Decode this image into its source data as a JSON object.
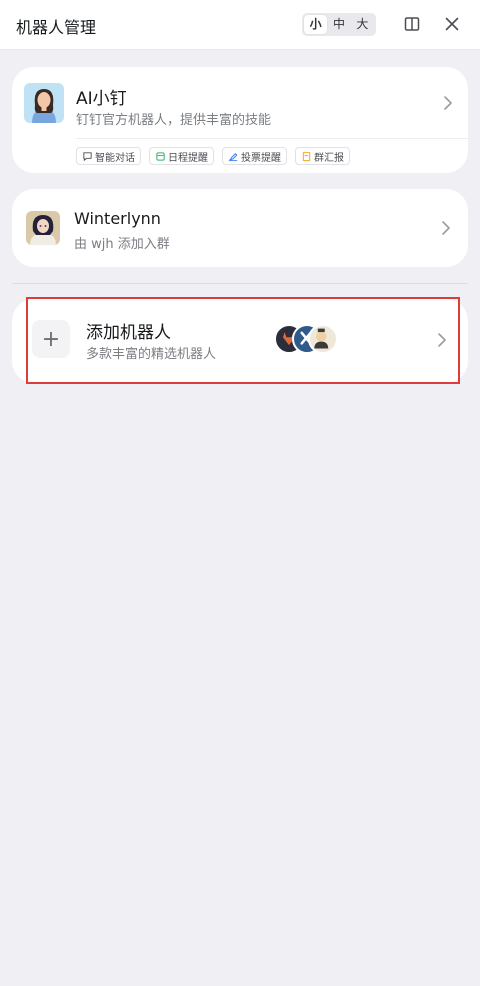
{
  "header": {
    "title": "机器人管理",
    "size_options": [
      "小",
      "中",
      "大"
    ],
    "size_selected": "小",
    "icons": [
      "split-panel-icon",
      "close-icon"
    ]
  },
  "bots": [
    {
      "name": "AI小钉",
      "description": "钉钉官方机器人，提供丰富的技能",
      "tags": [
        {
          "label": "智能对话",
          "icon": "chat-bubble-icon",
          "color": "#4a4d52"
        },
        {
          "label": "日程提醒",
          "icon": "calendar-icon",
          "color": "#33b36b"
        },
        {
          "label": "投票提醒",
          "icon": "vote-icon",
          "color": "#3d7ef5"
        },
        {
          "label": "群汇报",
          "icon": "report-icon",
          "color": "#f5a623"
        }
      ]
    },
    {
      "name": "Winterlynn",
      "description": "由 wjh 添加入群"
    }
  ],
  "add_bot": {
    "plus": "+",
    "title": "添加机器人",
    "description": "多款丰富的精选机器人"
  },
  "colors": {
    "background": "#f0eff4",
    "card": "#ffffff",
    "highlight_border": "#e03b3b"
  }
}
